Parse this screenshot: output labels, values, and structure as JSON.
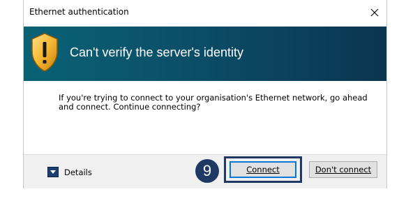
{
  "window": {
    "title": "Ethernet authentication",
    "close_icon": "close-icon"
  },
  "banner": {
    "heading": "Can't verify the server's identity",
    "icon": "warning-shield-icon",
    "color": "#0b4e68"
  },
  "message": {
    "text": "If you're trying to connect to your organisation's Ethernet network, go ahead and connect. Continue connecting?"
  },
  "footer": {
    "details_label": "Details",
    "details_icon": "chevron-down-icon",
    "step_number": "9",
    "connect_label": "Connect",
    "dont_connect_label": "Don't connect",
    "accent": "#1f3864"
  }
}
